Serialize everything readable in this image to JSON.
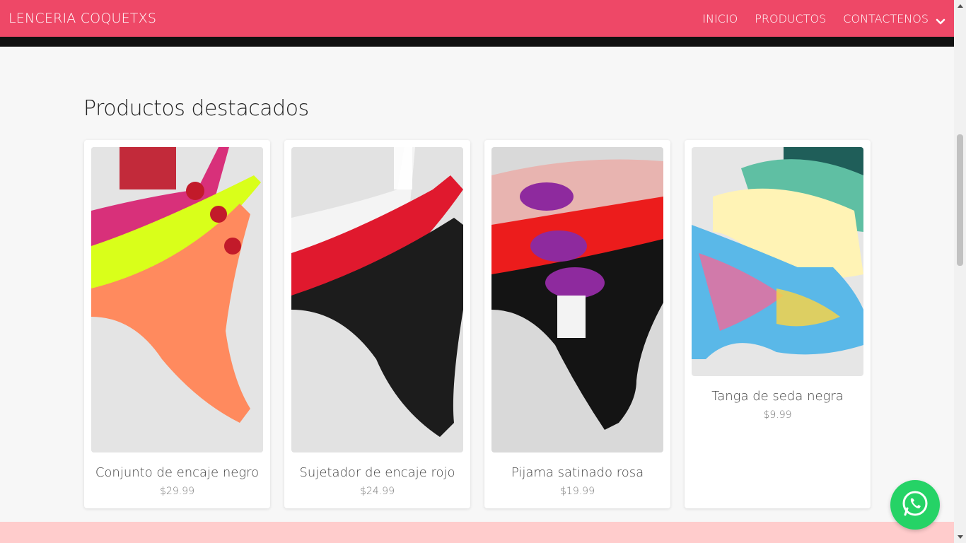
{
  "nav": {
    "brand": "LENCERIA COQUETXS",
    "links": [
      "INICIO",
      "PRODUCTOS",
      "CONTACTENOS"
    ]
  },
  "section": {
    "title": "Productos destacados"
  },
  "products": [
    {
      "name": "Conjunto de encaje negro",
      "price": "$29.99"
    },
    {
      "name": "Sujetador de encaje rojo",
      "price": "$24.99"
    },
    {
      "name": "Pijama satinado rosa",
      "price": "$19.99"
    },
    {
      "name": "Tanga de seda negra",
      "price": "$9.99"
    }
  ],
  "colors": {
    "navbar": "#ee4867",
    "whatsapp": "#25d366",
    "footer_band": "#ffcccc"
  },
  "icons": {
    "dropdown": "chevron-down-icon",
    "whatsapp": "whatsapp-icon"
  }
}
